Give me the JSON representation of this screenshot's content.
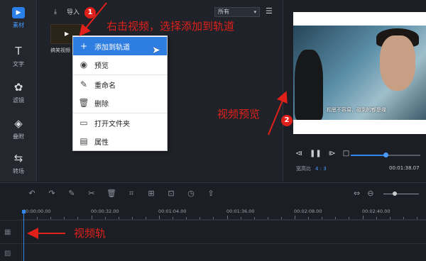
{
  "nav": {
    "items": [
      {
        "icon": "video-icon",
        "label": "素材",
        "glyph": "▶"
      },
      {
        "icon": "text-icon",
        "label": "文字",
        "glyph": "T"
      },
      {
        "icon": "filter-icon",
        "label": "滤镜",
        "glyph": "✿"
      },
      {
        "icon": "overlay-icon",
        "label": "叠附",
        "glyph": "◈"
      },
      {
        "icon": "transition-icon",
        "label": "转场",
        "glyph": "⇆"
      }
    ]
  },
  "media": {
    "import_label": "导入",
    "filter_value": "所有",
    "thumb_label": "搞笑视频"
  },
  "context_menu": {
    "items": [
      {
        "icon": "plus-icon",
        "glyph": "+",
        "label": "添加到轨道"
      },
      {
        "icon": "eye-icon",
        "glyph": "◉",
        "label": "预览"
      },
      {
        "icon": "pencil-icon",
        "glyph": "✎",
        "label": "重命名"
      },
      {
        "icon": "trash-icon",
        "glyph": "🗑",
        "label": "删除"
      },
      {
        "icon": "folder-icon",
        "glyph": "▭",
        "label": "打开文件夹"
      },
      {
        "icon": "file-icon",
        "glyph": "▤",
        "label": "属性"
      }
    ]
  },
  "preview": {
    "subtitle": "相思不容易，碰到的都是缘",
    "ratio_label": "宽高比",
    "ratio_value": "4 : 3",
    "time": "00:01:38.07",
    "progress": 0.47
  },
  "timeline": {
    "ticks": [
      "00:00:00.00",
      "00:00:32.00",
      "00:01:04.00",
      "00:01:36.00",
      "00:02:08.00",
      "00:02:40.00"
    ]
  },
  "annotations": {
    "step1": "右击视频，选择添加到轨道",
    "step2": "视频预览",
    "track": "视频轨",
    "badge1": "1",
    "badge2": "2"
  },
  "colors": {
    "accent": "#2e7de0",
    "annotation": "#e0201a"
  }
}
